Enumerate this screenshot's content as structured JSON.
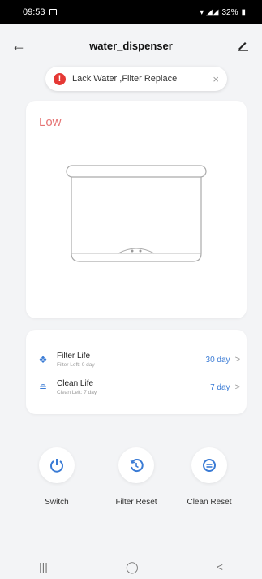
{
  "status_bar": {
    "time": "09:53",
    "battery": "32%"
  },
  "header": {
    "title": "water_dispenser"
  },
  "alert": {
    "text": "Lack Water ,Filter Replace",
    "close": "×"
  },
  "device": {
    "level": "Low"
  },
  "life": [
    {
      "name": "Filter Life",
      "sub": "Filter Left: 0 day",
      "value": "30 day",
      "icon": "filter-icon"
    },
    {
      "name": "Clean Life",
      "sub": "Clean Left: 7 day",
      "value": "7 day",
      "icon": "clean-icon"
    }
  ],
  "actions": [
    {
      "label": "Switch",
      "icon": "power-icon"
    },
    {
      "label": "Filter Reset",
      "icon": "reset-icon"
    },
    {
      "label": "Clean Reset",
      "icon": "clean-reset-icon"
    }
  ],
  "nav": {
    "recent": "|||",
    "home": "◯",
    "back": "<"
  },
  "colors": {
    "accent": "#3a7bd5",
    "warning": "#e53935",
    "level": "#e57373"
  }
}
